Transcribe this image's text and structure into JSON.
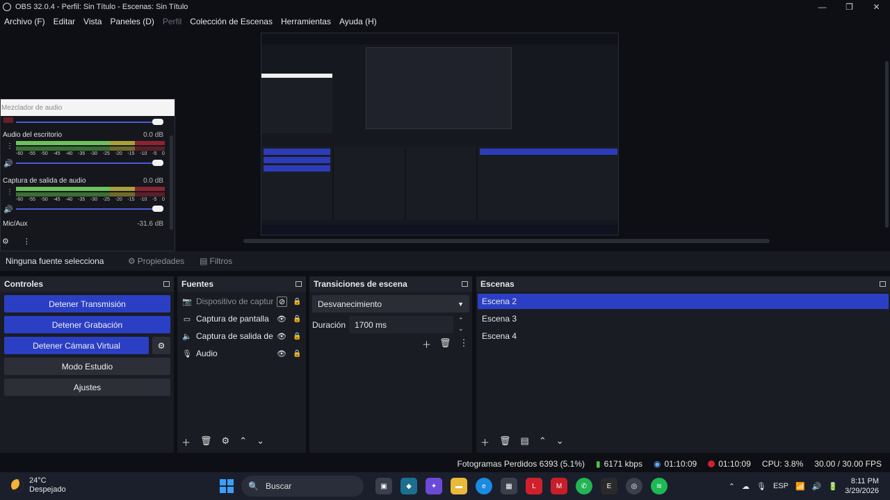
{
  "window": {
    "title": "OBS 32.0.4 - Perfil: Sin Título - Escenas: Sin Título",
    "min": "—",
    "max": "❐",
    "close": "✕"
  },
  "menu": [
    {
      "label": "Archivo (F)",
      "disabled": false
    },
    {
      "label": "Editar",
      "disabled": false
    },
    {
      "label": "Vista",
      "disabled": false
    },
    {
      "label": "Paneles (D)",
      "disabled": false
    },
    {
      "label": "Perfil",
      "disabled": true
    },
    {
      "label": "Colección de Escenas",
      "disabled": false
    },
    {
      "label": "Herramientas",
      "disabled": false
    },
    {
      "label": "Ayuda (H)",
      "disabled": false
    }
  ],
  "mixer": {
    "title": "Mezclador de audio",
    "channels": [
      {
        "name": "Audio del escritorio",
        "db": "0.0 dB"
      },
      {
        "name": "Captura de salida de audio",
        "db": "0.0 dB"
      }
    ],
    "mic": {
      "name": "Mic/Aux",
      "db": "-31.6 dB"
    },
    "scale": [
      "-60",
      "-55",
      "-50",
      "-45",
      "-40",
      "-35",
      "-30",
      "-25",
      "-20",
      "-15",
      "-10",
      "-5",
      "0"
    ]
  },
  "context": {
    "no_source": "Ninguna fuente selecciona",
    "properties": "Propiedades",
    "filters": "Filtros"
  },
  "controls": {
    "title": "Controles",
    "stop_stream": "Detener Transmisión",
    "stop_record": "Detener Grabación",
    "stop_vcam": "Detener Cámara Virtual",
    "studio_mode": "Modo Estudio",
    "settings": "Ajustes"
  },
  "sources": {
    "title": "Fuentes",
    "items": [
      {
        "name": "Dispositivo de captura de video",
        "icon": "camera-icon"
      },
      {
        "name": "Captura de pantalla",
        "icon": "monitor-icon"
      },
      {
        "name": "Captura de salida de audio",
        "icon": "speaker-icon"
      },
      {
        "name": "Audio",
        "icon": "mic-icon"
      }
    ]
  },
  "transitions": {
    "title": "Transiciones de escena",
    "selected": "Desvanecimiento",
    "duration_label": "Duración",
    "duration_value": "1700 ms"
  },
  "scenes": {
    "title": "Escenas",
    "items": [
      "Escena 2",
      "Escena 3",
      "Escena 4"
    ],
    "selected_index": 0
  },
  "status": {
    "dropped": "Fotogramas Perdidos 6393 (5.1%)",
    "bitrate": "6171 kbps",
    "stream_time": "01:10:09",
    "rec_time": "01:10:09",
    "cpu": "CPU: 3.8%",
    "fps": "30.00 / 30.00 FPS"
  },
  "taskbar": {
    "temp": "24°C",
    "weather": "Despejado",
    "search": "Buscar",
    "lang": "ESP",
    "time": "8:11 PM",
    "date": "3/29/2026"
  },
  "colors": {
    "accent": "#2b3fc4",
    "record": "#d4202c"
  }
}
